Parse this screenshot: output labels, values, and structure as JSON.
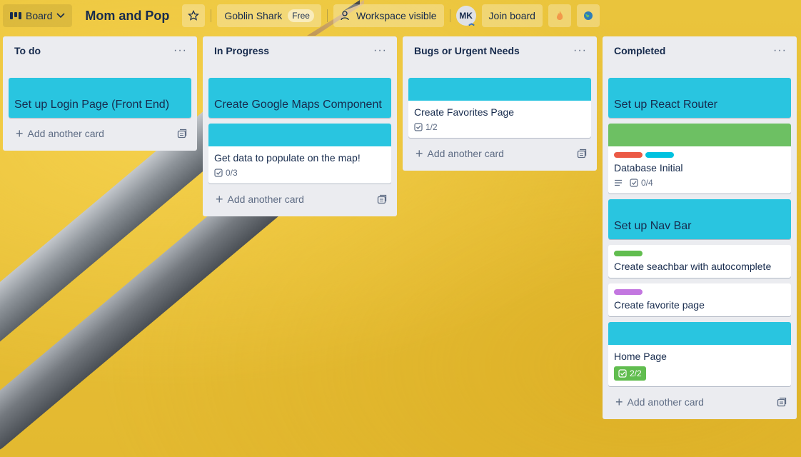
{
  "header": {
    "board_view_label": "Board",
    "board_title": "Mom and Pop",
    "workspace_name": "Goblin Shark",
    "workspace_plan": "Free",
    "visibility_label": "Workspace visible",
    "avatar_initials": "MK",
    "join_label": "Join board"
  },
  "lists": [
    {
      "title": "To do",
      "add_label": "Add another card",
      "cards": [
        {
          "title": "Set up Login Page (Front End)"
        }
      ]
    },
    {
      "title": "In Progress",
      "add_label": "Add another card",
      "cards": [
        {
          "title": "Create Google Maps Component"
        },
        {
          "title": "Get data to populate on the map!",
          "checklist": "0/3"
        }
      ]
    },
    {
      "title": "Bugs or Urgent Needs",
      "add_label": "Add another card",
      "cards": [
        {
          "title": "Create Favorites Page",
          "checklist": "1/2"
        }
      ]
    },
    {
      "title": "Completed",
      "add_label": "Add another card",
      "cards": [
        {
          "title": "Set up React Router"
        },
        {
          "title": "Database Initial",
          "checklist": "0/4"
        },
        {
          "title": "Set up Nav Bar"
        },
        {
          "title": "Create seachbar with autocomplete"
        },
        {
          "title": "Create favorite page"
        },
        {
          "title": "Home Page",
          "checklist": "2/2"
        }
      ]
    }
  ],
  "colors": {
    "cover_cyan": "#29c5e0",
    "cover_green": "#6dc063",
    "label_red": "#eb5a46",
    "label_cyan": "#00c2e0",
    "label_green": "#61bd4f",
    "label_purple": "#c377e0",
    "list_bg": "#ebecf0"
  }
}
